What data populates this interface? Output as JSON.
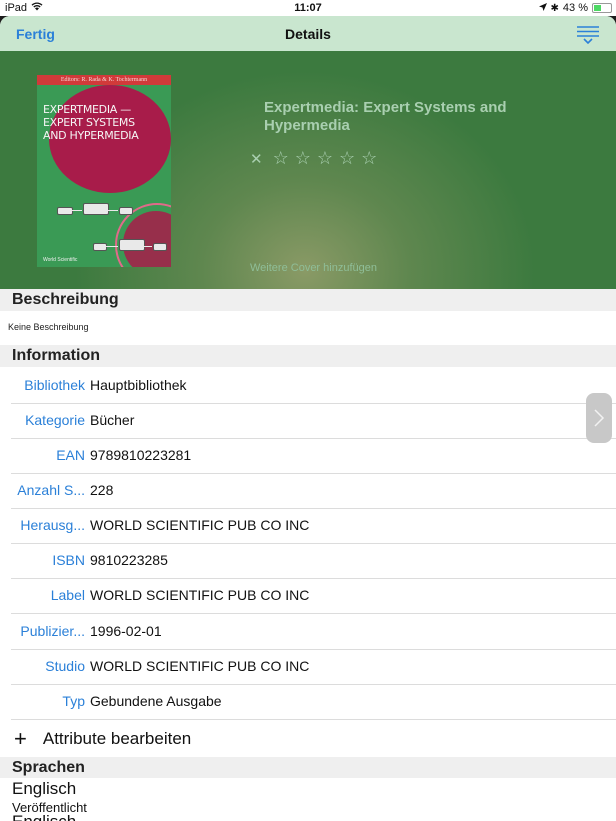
{
  "status_bar": {
    "device": "iPad",
    "time": "11:07",
    "battery": "43 %",
    "battery_level": 0.43,
    "wifi_icon": "wifi-icon",
    "bluetooth_icon": "bluetooth-icon",
    "location_icon": "location-arrow-icon"
  },
  "navbar": {
    "done_label": "Fertig",
    "title": "Details",
    "filter_icon": "filter-lines-icon"
  },
  "hero": {
    "cover": {
      "editors": "Editors: R. Rada & K. Tochtermann",
      "title_line1": "EXPERTMEDIA —",
      "title_line2": "EXPERT SYSTEMS",
      "title_line3": "AND HYPERMEDIA",
      "publisher": "World Scientific"
    },
    "book_title": "Expertmedia: Expert Systems and Hypermedia",
    "rating": {
      "clear_icon": "close-icon",
      "stars": 5,
      "value": 0,
      "star_glyph": "☆"
    },
    "more_covers": "Weitere Cover hinzufügen"
  },
  "description": {
    "header": "Beschreibung",
    "text": "Keine Beschreibung"
  },
  "information": {
    "header": "Information",
    "rows": [
      {
        "key": "Bibliothek",
        "value": "Hauptbibliothek"
      },
      {
        "key": "Kategorie",
        "value": "Bücher"
      },
      {
        "key": "EAN",
        "value": "9789810223281"
      },
      {
        "key": "Anzahl S...",
        "value": "228"
      },
      {
        "key": "Herausg...",
        "value": "WORLD SCIENTIFIC PUB CO INC"
      },
      {
        "key": "ISBN",
        "value": "9810223285"
      },
      {
        "key": "Label",
        "value": "WORLD SCIENTIFIC PUB CO INC"
      },
      {
        "key": "Publizier...",
        "value": "1996-02-01"
      },
      {
        "key": "Studio",
        "value": "WORLD SCIENTIFIC PUB CO INC"
      },
      {
        "key": "Typ",
        "value": "Gebundene Ausgabe"
      }
    ],
    "edit_label": "Attribute bearbeiten"
  },
  "languages": {
    "header": "Sprachen",
    "primary": "Englisch",
    "published_label": "Veröffentlicht",
    "published_value": "Englisch"
  },
  "pager_handle": {
    "icon": "chevron-right-icon"
  }
}
